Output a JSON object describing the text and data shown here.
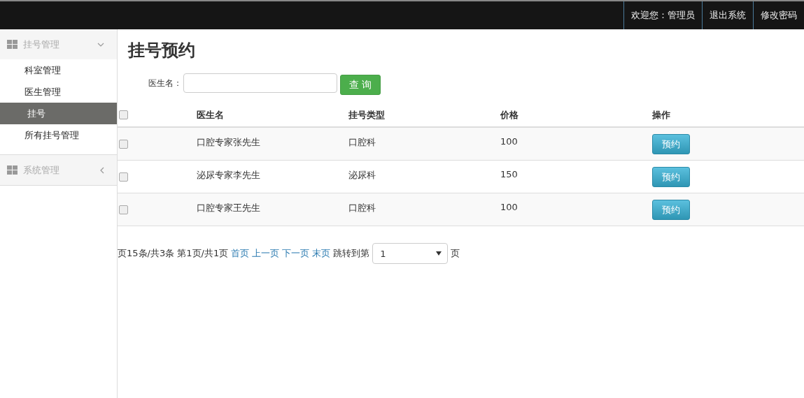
{
  "top_bar": {
    "links": [
      {
        "label": "欢迎您：管理员"
      },
      {
        "label": "退出系统"
      },
      {
        "label": "修改密码"
      }
    ]
  },
  "sidebar": {
    "groups": [
      {
        "label": "挂号管理",
        "expanded": true,
        "items": [
          {
            "label": "科室管理",
            "selected": false
          },
          {
            "label": "医生管理",
            "selected": false
          },
          {
            "label": "挂号",
            "selected": true
          },
          {
            "label": "所有挂号管理",
            "selected": false
          }
        ]
      },
      {
        "label": "系统管理",
        "expanded": false
      }
    ]
  },
  "page_title": "挂号预约",
  "search": {
    "label": "医生名：",
    "button": "查 询"
  },
  "table": {
    "all_checked": false,
    "columns": [
      "医生名",
      "挂号类型",
      "价格",
      "操作"
    ],
    "rows": [
      {
        "checked": false,
        "cells": [
          "口腔专家张先生",
          "口腔科",
          "100"
        ],
        "action": "预约"
      },
      {
        "checked": false,
        "cells": [
          "泌尿专家李先生",
          "泌尿科",
          "150"
        ],
        "action": "预约"
      },
      {
        "checked": false,
        "cells": [
          "口腔专家王先生",
          "口腔科",
          "100"
        ],
        "action": "预约"
      }
    ]
  },
  "pagination": {
    "summary": "页15条/共3条 第1页/共1页",
    "links": [
      "首页",
      "上一页",
      "下一页",
      "末页"
    ],
    "jump_label": "跳转到第",
    "page_select": "1",
    "page_suffix": "页"
  }
}
